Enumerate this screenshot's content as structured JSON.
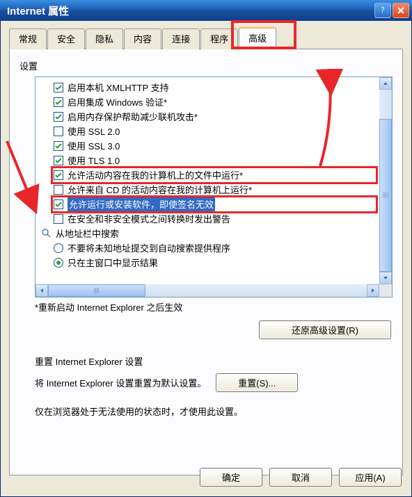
{
  "window": {
    "title": "Internet 属性"
  },
  "tabs": [
    {
      "label": "常规",
      "active": false
    },
    {
      "label": "安全",
      "active": false
    },
    {
      "label": "隐私",
      "active": false
    },
    {
      "label": "内容",
      "active": false
    },
    {
      "label": "连接",
      "active": false
    },
    {
      "label": "程序",
      "active": false
    },
    {
      "label": "高级",
      "active": true
    }
  ],
  "settings": {
    "label": "设置",
    "items": [
      {
        "type": "checkbox",
        "checked": true,
        "label": "启用本机 XMLHTTP 支持"
      },
      {
        "type": "checkbox",
        "checked": true,
        "label": "启用集成 Windows 验证*"
      },
      {
        "type": "checkbox",
        "checked": true,
        "label": "启用内存保护帮助减少联机攻击*"
      },
      {
        "type": "checkbox",
        "checked": false,
        "label": "使用 SSL 2.0"
      },
      {
        "type": "checkbox",
        "checked": true,
        "label": "使用 SSL 3.0"
      },
      {
        "type": "checkbox",
        "checked": true,
        "label": "使用 TLS 1.0"
      },
      {
        "type": "checkbox",
        "checked": true,
        "label": "允许活动内容在我的计算机上的文件中运行*",
        "red": true
      },
      {
        "type": "checkbox",
        "checked": false,
        "label": "允许来自 CD 的活动内容在我的计算机上运行*"
      },
      {
        "type": "checkbox",
        "checked": true,
        "label": "允许运行或安装软件，即使签名无效",
        "red": true,
        "selected": true
      },
      {
        "type": "checkbox",
        "checked": false,
        "label": "在安全和非安全模式之间转换时发出警告"
      },
      {
        "type": "header",
        "label": "从地址栏中搜索"
      },
      {
        "type": "radio",
        "checked": false,
        "label": "不要将未知地址提交到自动搜索提供程序"
      },
      {
        "type": "radio",
        "checked": true,
        "label": "只在主窗口中显示结果"
      }
    ],
    "footnote": "*重新启动 Internet Explorer 之后生效",
    "restoreButton": "还原高级设置(R)"
  },
  "reset": {
    "title": "重置 Internet Explorer 设置",
    "desc": "将 Internet Explorer 设置重置为默认设置。",
    "button": "重置(S)...",
    "note": "仅在浏览器处于无法使用的状态时，才使用此设置。"
  },
  "bottom": {
    "ok": "确定",
    "cancel": "取消",
    "apply": "应用(A)"
  }
}
